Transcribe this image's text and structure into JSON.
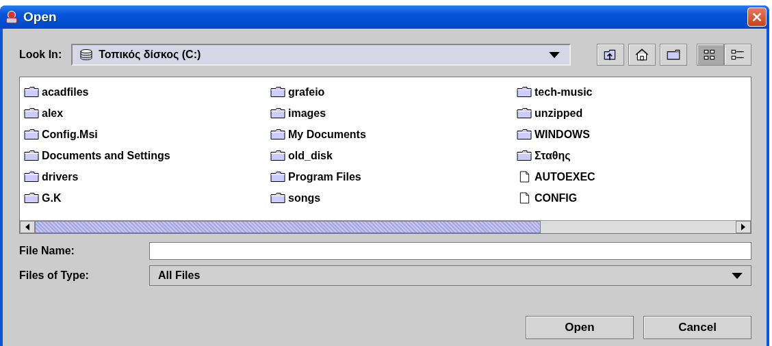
{
  "window": {
    "title": "Open"
  },
  "look_in": {
    "label": "Look In:",
    "value": "Τοπικός δίσκος (C:)"
  },
  "toolbar": [
    {
      "kind": "up",
      "selected": false
    },
    {
      "kind": "home",
      "selected": false
    },
    {
      "kind": "newfolder",
      "selected": false
    },
    {
      "kind": "list",
      "selected": true
    },
    {
      "kind": "details",
      "selected": false
    }
  ],
  "files": [
    {
      "name": "acadfiles",
      "kind": "folder"
    },
    {
      "name": "alex",
      "kind": "folder"
    },
    {
      "name": "Config.Msi",
      "kind": "folder"
    },
    {
      "name": "Documents and Settings",
      "kind": "folder"
    },
    {
      "name": "drivers",
      "kind": "folder"
    },
    {
      "name": "G.K",
      "kind": "folder"
    },
    {
      "name": "grafeio",
      "kind": "folder"
    },
    {
      "name": "images",
      "kind": "folder"
    },
    {
      "name": "My Documents",
      "kind": "folder"
    },
    {
      "name": "old_disk",
      "kind": "folder"
    },
    {
      "name": "Program Files",
      "kind": "folder"
    },
    {
      "name": "songs",
      "kind": "folder"
    },
    {
      "name": "tech-music",
      "kind": "folder"
    },
    {
      "name": "unzipped",
      "kind": "folder"
    },
    {
      "name": "WINDOWS",
      "kind": "folder"
    },
    {
      "name": "Σταθης",
      "kind": "folder"
    },
    {
      "name": "AUTOEXEC",
      "kind": "file"
    },
    {
      "name": "CONFIG",
      "kind": "file"
    }
  ],
  "file_name": {
    "label": "File Name:"
  },
  "file_type": {
    "label": "Files of Type:",
    "value": "All Files"
  },
  "buttons": [
    "Open",
    "Cancel"
  ]
}
